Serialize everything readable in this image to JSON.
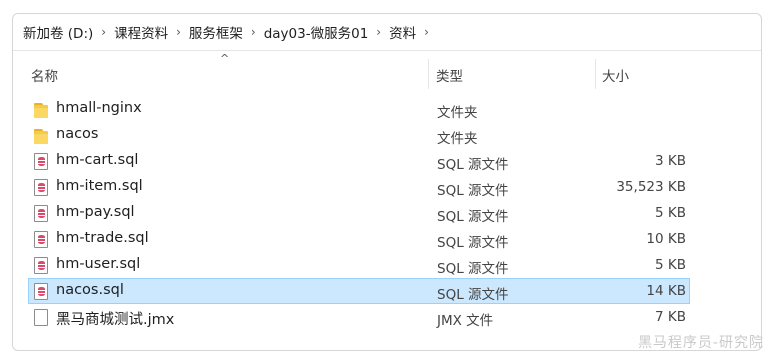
{
  "breadcrumb": [
    "新加卷 (D:)",
    "课程资料",
    "服务框架",
    "day03-微服务01",
    "资料"
  ],
  "breadcrumb_separator": "›",
  "columns": {
    "name": "名称",
    "type": "类型",
    "size": "大小"
  },
  "files": [
    {
      "name": "hmall-nginx",
      "type": "文件夹",
      "size": "",
      "icon": "folder-icon"
    },
    {
      "name": "nacos",
      "type": "文件夹",
      "size": "",
      "icon": "folder-icon"
    },
    {
      "name": "hm-cart.sql",
      "type": "SQL 源文件",
      "size": "3 KB",
      "icon": "sql-file-icon"
    },
    {
      "name": "hm-item.sql",
      "type": "SQL 源文件",
      "size": "35,523 KB",
      "icon": "sql-file-icon"
    },
    {
      "name": "hm-pay.sql",
      "type": "SQL 源文件",
      "size": "5 KB",
      "icon": "sql-file-icon"
    },
    {
      "name": "hm-trade.sql",
      "type": "SQL 源文件",
      "size": "10 KB",
      "icon": "sql-file-icon"
    },
    {
      "name": "hm-user.sql",
      "type": "SQL 源文件",
      "size": "5 KB",
      "icon": "sql-file-icon"
    },
    {
      "name": "nacos.sql",
      "type": "SQL 源文件",
      "size": "14 KB",
      "icon": "sql-file-icon",
      "selected": true
    },
    {
      "name": "黑马商城测试.jmx",
      "type": "JMX 文件",
      "size": "7 KB",
      "icon": "file-icon"
    }
  ],
  "watermark": "黑马程序员-研究院",
  "colors": {
    "selection_bg": "#cce8ff",
    "selection_border": "#99d1ff",
    "folder": "#f7c948",
    "sql_icon": "#d94a6a"
  }
}
